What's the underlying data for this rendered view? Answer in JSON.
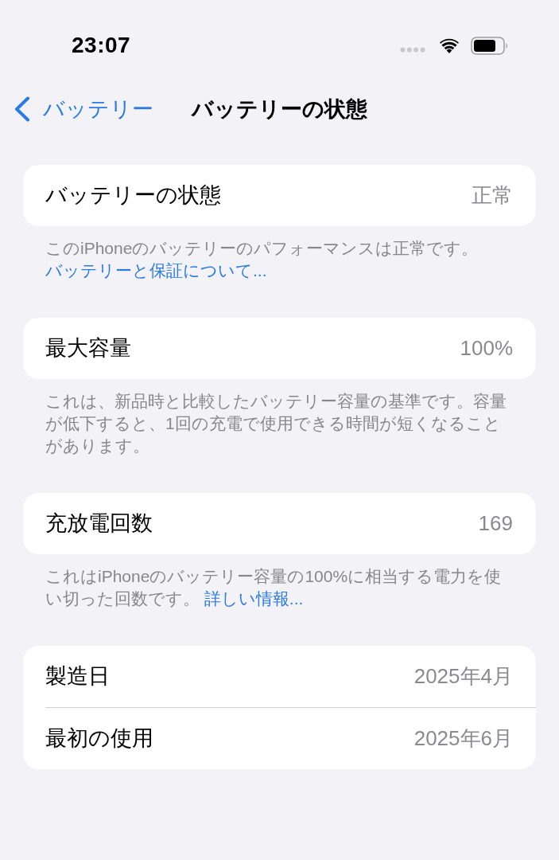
{
  "status_bar": {
    "time": "23:07"
  },
  "nav": {
    "back": "バッテリー",
    "title": "バッテリーの状態"
  },
  "sections": [
    {
      "rows": [
        {
          "label": "バッテリーの状態",
          "value": "正常"
        }
      ],
      "footer": {
        "text": "このiPhoneのバッテリーのパフォーマンスは正常です。",
        "link": "バッテリーと保証について..."
      }
    },
    {
      "rows": [
        {
          "label": "最大容量",
          "value": "100%"
        }
      ],
      "footer": {
        "text": "これは、新品時と比較したバッテリー容量の基準です。容量が低下すると、1回の充電で使用できる時間が短くなることがあります。"
      }
    },
    {
      "rows": [
        {
          "label": "充放電回数",
          "value": "169"
        }
      ],
      "footer": {
        "text": "これはiPhoneのバッテリー容量の100%に相当する電力を使い切った回数です。 ",
        "link": "詳しい情報..."
      }
    },
    {
      "rows": [
        {
          "label": "製造日",
          "value": "2025年4月"
        },
        {
          "label": "最初の使用",
          "value": "2025年6月"
        }
      ]
    }
  ]
}
